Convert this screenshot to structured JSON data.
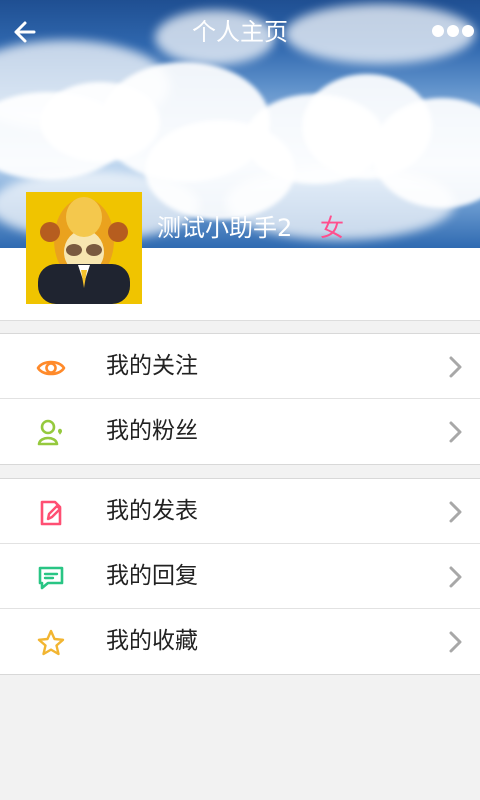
{
  "topbar": {
    "title": "个人主页",
    "back_icon": "arrow-left-icon",
    "more_icon": "more-dots-icon"
  },
  "profile": {
    "username": "测试小助手2",
    "gender": "女",
    "avatar": "avatar-image"
  },
  "menu": {
    "group1": [
      {
        "label": "我的关注",
        "icon": "eye-icon",
        "color": "#ff8a2a"
      },
      {
        "label": "我的粉丝",
        "icon": "user-heart-icon",
        "color": "#95c93d"
      }
    ],
    "group2": [
      {
        "label": "我的发表",
        "icon": "edit-document-icon",
        "color": "#ff4f73"
      },
      {
        "label": "我的回复",
        "icon": "comment-icon",
        "color": "#29c584"
      },
      {
        "label": "我的收藏",
        "icon": "star-icon",
        "color": "#f2b531"
      }
    ]
  },
  "colors": {
    "background": "#f2f2f2",
    "white": "#ffffff",
    "divider": "#d8d8d8",
    "text": "#222222",
    "chevron": "#a8a8a8",
    "header_blue": "#2f67ae",
    "avatar_yellow": "#f0c400",
    "gender_pink": "#ff4f8d"
  }
}
